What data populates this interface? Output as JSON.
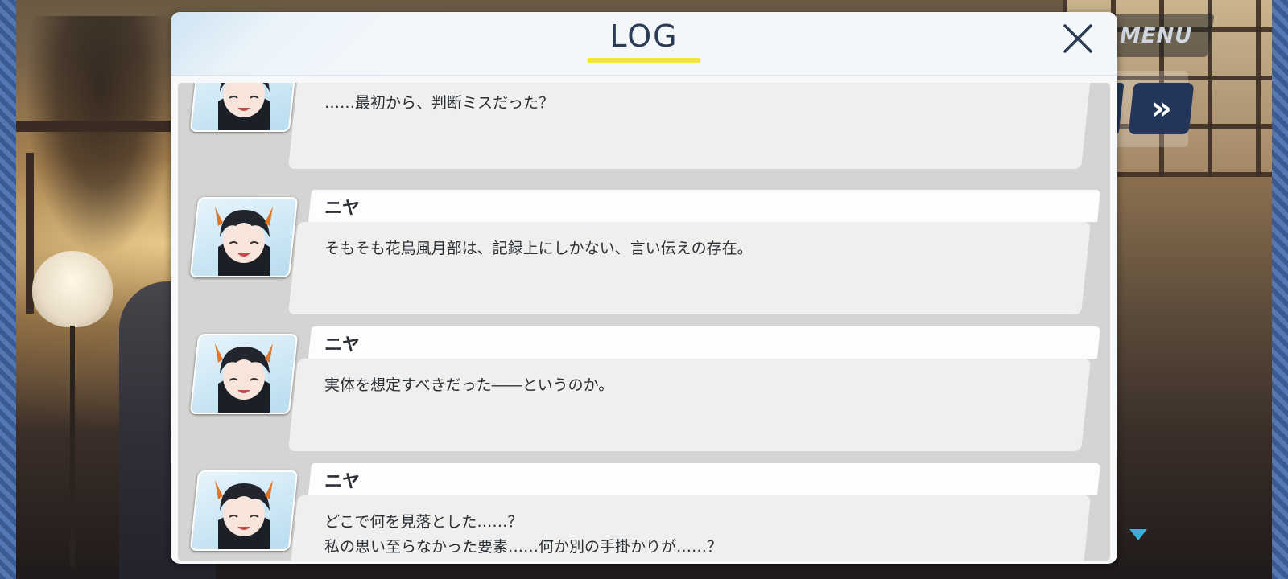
{
  "menu": {
    "label": "MENU"
  },
  "controls": {
    "auto_label": "»"
  },
  "log": {
    "title": "LOG",
    "entries": [
      {
        "name": "",
        "text": "……最初から、判断ミスだった？"
      },
      {
        "name": "ニヤ",
        "text": "そもそも花鳥風月部は、記録上にしかない、言い伝えの存在。"
      },
      {
        "name": "ニヤ",
        "text": "実体を想定すべきだった――というのか。"
      },
      {
        "name": "ニヤ",
        "text": "どこで何を見落とした……？\n私の思い至らなかった要素……何か別の手掛かりが……？"
      }
    ]
  }
}
